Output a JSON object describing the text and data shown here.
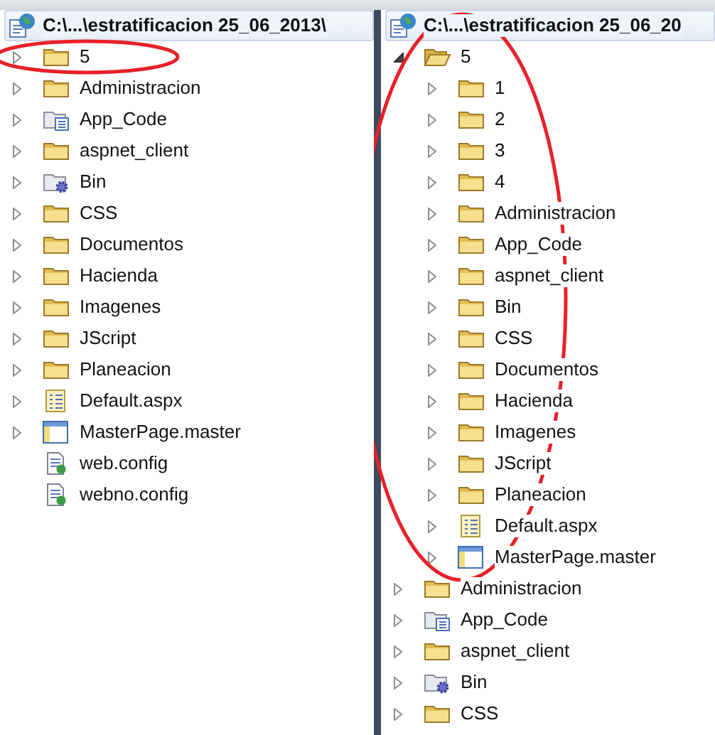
{
  "panels": [
    {
      "root": {
        "label": "C:\\...\\estratificacion 25_06_2013\\",
        "children": [
          {
            "label": "5",
            "kind": "folder",
            "expanded": false,
            "circled": true
          },
          {
            "label": "Administracion",
            "kind": "folder",
            "expanded": false
          },
          {
            "label": "App_Code",
            "kind": "code-folder",
            "expanded": false
          },
          {
            "label": "aspnet_client",
            "kind": "folder",
            "expanded": false
          },
          {
            "label": "Bin",
            "kind": "bin-folder",
            "expanded": false
          },
          {
            "label": "CSS",
            "kind": "folder",
            "expanded": false
          },
          {
            "label": "Documentos",
            "kind": "folder",
            "expanded": false
          },
          {
            "label": "Hacienda",
            "kind": "folder",
            "expanded": false
          },
          {
            "label": "Imagenes",
            "kind": "folder",
            "expanded": false
          },
          {
            "label": "JScript",
            "kind": "folder",
            "expanded": false
          },
          {
            "label": "Planeacion",
            "kind": "folder",
            "expanded": false
          },
          {
            "label": "Default.aspx",
            "kind": "page",
            "expanded": false
          },
          {
            "label": "MasterPage.master",
            "kind": "master",
            "expanded": false
          },
          {
            "label": "web.config",
            "kind": "config"
          },
          {
            "label": "webno.config",
            "kind": "config"
          }
        ]
      }
    },
    {
      "root": {
        "label": "C:\\...\\estratificacion 25_06_20",
        "children": [
          {
            "label": "5",
            "kind": "folder",
            "expanded": true,
            "circled": true,
            "children": [
              {
                "label": "1",
                "kind": "folder",
                "expanded": false
              },
              {
                "label": "2",
                "kind": "folder",
                "expanded": false
              },
              {
                "label": "3",
                "kind": "folder",
                "expanded": false
              },
              {
                "label": "4",
                "kind": "folder",
                "expanded": false
              },
              {
                "label": "Administracion",
                "kind": "folder",
                "expanded": false
              },
              {
                "label": "App_Code",
                "kind": "folder",
                "expanded": false
              },
              {
                "label": "aspnet_client",
                "kind": "folder",
                "expanded": false
              },
              {
                "label": "Bin",
                "kind": "folder",
                "expanded": false
              },
              {
                "label": "CSS",
                "kind": "folder",
                "expanded": false
              },
              {
                "label": "Documentos",
                "kind": "folder",
                "expanded": false
              },
              {
                "label": "Hacienda",
                "kind": "folder",
                "expanded": false
              },
              {
                "label": "Imagenes",
                "kind": "folder",
                "expanded": false
              },
              {
                "label": "JScript",
                "kind": "folder",
                "expanded": false
              },
              {
                "label": "Planeacion",
                "kind": "folder",
                "expanded": false
              },
              {
                "label": "Default.aspx",
                "kind": "page",
                "expanded": false
              },
              {
                "label": "MasterPage.master",
                "kind": "master",
                "expanded": false
              }
            ]
          },
          {
            "label": "Administracion",
            "kind": "folder",
            "expanded": false
          },
          {
            "label": "App_Code",
            "kind": "code-folder",
            "expanded": false
          },
          {
            "label": "aspnet_client",
            "kind": "folder",
            "expanded": false
          },
          {
            "label": "Bin",
            "kind": "bin-folder",
            "expanded": false
          },
          {
            "label": "CSS",
            "kind": "folder",
            "expanded": false
          }
        ]
      }
    }
  ]
}
